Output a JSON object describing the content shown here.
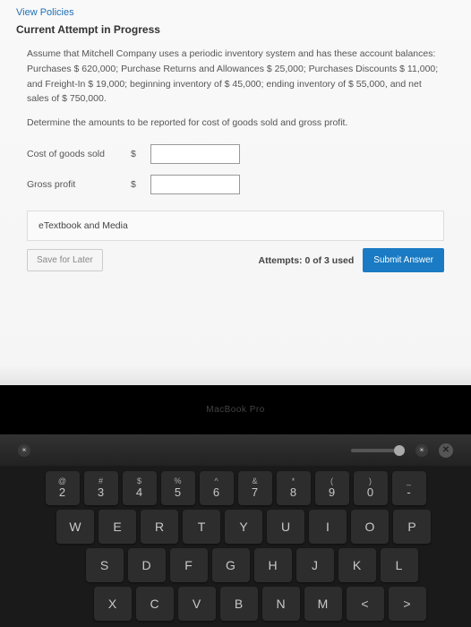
{
  "header": {
    "policies_link": "View Policies",
    "attempt_title": "Current Attempt in Progress"
  },
  "problem": {
    "body": "Assume that Mitchell Company uses a periodic inventory system and has these account balances: Purchases $ 620,000; Purchase Returns and Allowances $ 25,000; Purchases Discounts $ 11,000; and Freight-In $ 19,000; beginning inventory of $ 45,000; ending inventory of $ 55,000, and net sales of $ 750,000.",
    "instruction": "Determine the amounts to be reported for cost of goods sold and gross profit."
  },
  "answers": {
    "cogs_label": "Cost of goods sold",
    "gross_profit_label": "Gross profit",
    "currency": "$",
    "cogs_value": "",
    "gross_profit_value": ""
  },
  "resources": {
    "title": "eTextbook and Media"
  },
  "actions": {
    "save_label": "Save for Later",
    "attempts_text": "Attempts: 0 of 3 used",
    "submit_label": "Submit Answer"
  },
  "laptop": {
    "label": "MacBook Pro"
  },
  "touchbar": {
    "sun_low": "☀",
    "sun_high": "☀",
    "close": "✕"
  },
  "keyboard": {
    "row1": [
      {
        "u": "@",
        "l": "2"
      },
      {
        "u": "#",
        "l": "3"
      },
      {
        "u": "$",
        "l": "4"
      },
      {
        "u": "%",
        "l": "5"
      },
      {
        "u": "^",
        "l": "6"
      },
      {
        "u": "&",
        "l": "7"
      },
      {
        "u": "*",
        "l": "8"
      },
      {
        "u": "(",
        "l": "9"
      },
      {
        "u": ")",
        "l": "0"
      },
      {
        "u": "_",
        "l": "-"
      }
    ],
    "row2": [
      "W",
      "E",
      "R",
      "T",
      "Y",
      "U",
      "I",
      "O",
      "P"
    ],
    "row3": [
      "S",
      "D",
      "F",
      "G",
      "H",
      "J",
      "K",
      "L"
    ],
    "row4": [
      "X",
      "C",
      "V",
      "B",
      "N",
      "M",
      "<",
      ">"
    ]
  }
}
